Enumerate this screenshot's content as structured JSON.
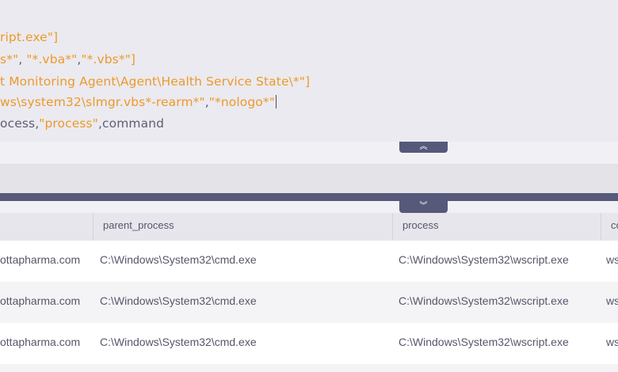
{
  "editor": {
    "lines": [
      [
        {
          "t": "ript.exe\"]",
          "c": "str"
        }
      ],
      [
        {
          "t": "s*\"",
          "c": "str"
        },
        {
          "t": ", ",
          "c": "plain"
        },
        {
          "t": "\"*.vba*\"",
          "c": "str"
        },
        {
          "t": ",",
          "c": "plain"
        },
        {
          "t": "\"*.vbs*\"]",
          "c": "str"
        }
      ],
      [
        {
          "t": "t Monitoring Agent\\Agent\\Health Service State\\*\"]",
          "c": "str"
        }
      ],
      [
        {
          "t": "ws\\system32\\slmgr.vbs*-rearm*\"",
          "c": "str"
        },
        {
          "t": ",",
          "c": "plain"
        },
        {
          "t": "\"*nologo*\"",
          "c": "str"
        }
      ],
      [
        {
          "t": "ocess,",
          "c": "plain"
        },
        {
          "t": "\"process\"",
          "c": "str"
        },
        {
          "t": ",command",
          "c": "plain"
        }
      ]
    ]
  },
  "handles": {
    "collapse_icon": "chevron-double-up-icon",
    "collapse_glyph": "︽",
    "expand_icon": "chevron-double-down-icon",
    "expand_glyph": "︾"
  },
  "table": {
    "columns": [
      "",
      "parent_process",
      "process",
      "co"
    ],
    "rows": [
      [
        "ottapharma.com",
        "C:\\Windows\\System32\\cmd.exe",
        "C:\\Windows\\System32\\wscript.exe",
        "ws"
      ],
      [
        "ottapharma.com",
        "C:\\Windows\\System32\\cmd.exe",
        "C:\\Windows\\System32\\wscript.exe",
        "ws"
      ],
      [
        "ottapharma.com",
        "C:\\Windows\\System32\\cmd.exe",
        "C:\\Windows\\System32\\wscript.exe",
        "ws"
      ]
    ]
  },
  "colors": {
    "string": "#ec9a2a",
    "plain": "#5d5f73",
    "handle": "#56597a"
  }
}
